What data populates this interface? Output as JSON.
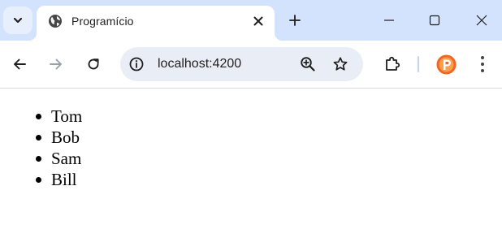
{
  "browser": {
    "tab": {
      "title": "Programício",
      "favicon": "globe-icon"
    },
    "controls": {
      "tab_search": "chevron-down-icon",
      "new_tab": "plus-icon",
      "minimize": "minimize-icon",
      "maximize": "maximize-icon",
      "close": "close-icon"
    },
    "toolbar": {
      "back": "back-arrow-icon",
      "forward": "forward-arrow-icon",
      "reload": "reload-icon",
      "url": "localhost:4200",
      "site_info": "info-icon",
      "zoom": "zoom-in-icon",
      "bookmark": "star-icon",
      "extensions": "puzzle-icon",
      "profile": "profile-avatar",
      "menu": "more-vert-icon"
    },
    "colors": {
      "tabstrip": "#d3e3fd",
      "omnibox": "#e9eef6",
      "avatar_orange": "#f26522"
    }
  },
  "page": {
    "names": [
      "Tom",
      "Bob",
      "Sam",
      "Bill"
    ]
  }
}
